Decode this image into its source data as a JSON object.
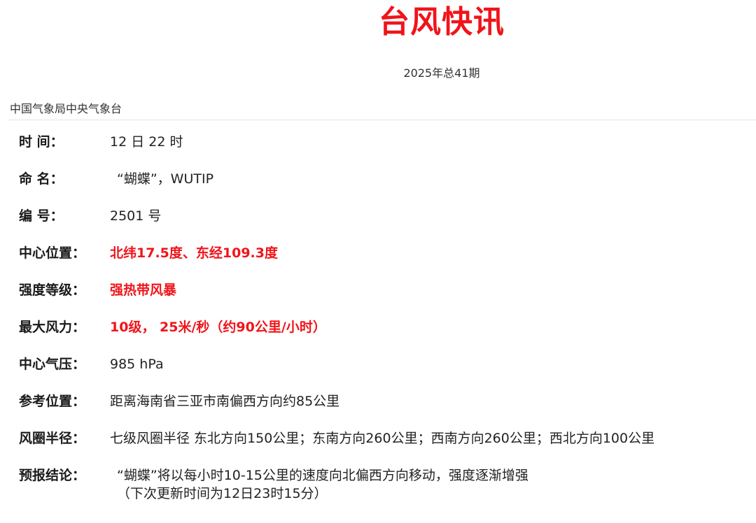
{
  "header": {
    "title": "台风快讯",
    "issue": "2025年总41期",
    "organization": "中国气象局中央气象台"
  },
  "colors": {
    "accent_red": "#f0141a",
    "text": "#222222",
    "divider": "#e6e6e6"
  },
  "report": {
    "time": {
      "label": "时 间：",
      "value": "12 日 22 时"
    },
    "name": {
      "label": "命 名：",
      "value": "“蝴蝶”，WUTIP"
    },
    "number": {
      "label": "编 号：",
      "value": "2501 号"
    },
    "center_position": {
      "label": "中心位置：",
      "value": "北纬17.5度、东经109.3度"
    },
    "intensity": {
      "label": "强度等级：",
      "value": "强热带风暴"
    },
    "max_wind": {
      "label": "最大风力：",
      "value": "10级， 25米/秒（约90公里/小时）"
    },
    "center_pressure": {
      "label": "中心气压：",
      "value": "985 hPa"
    },
    "reference_position": {
      "label": "参考位置：",
      "value": "距离海南省三亚市南偏西方向约85公里"
    },
    "wind_radius": {
      "label": "风圈半径：",
      "value": "七级风圈半径 东北方向150公里；东南方向260公里；西南方向260公里；西北方向100公里"
    },
    "forecast": {
      "label": "预报结论：",
      "value": "“蝴蝶”将以每小时10-15公里的速度向北偏西方向移动，强度逐渐增强",
      "note": "（下次更新时间为12日23时15分）"
    }
  }
}
